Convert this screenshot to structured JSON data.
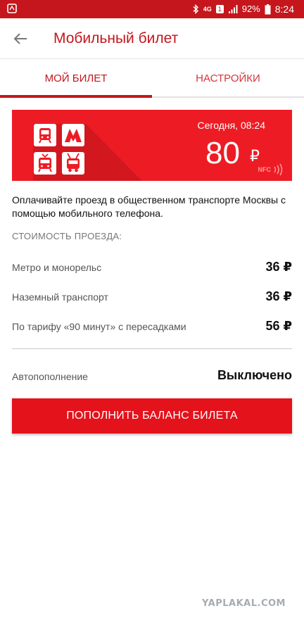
{
  "status_bar": {
    "network": "4G",
    "sim": "1",
    "battery": "92%",
    "time": "8:24",
    "icons": [
      "notification-icon",
      "bluetooth-icon",
      "signal-icon",
      "battery-icon"
    ]
  },
  "app_bar": {
    "title": "Мобильный билет",
    "back_icon": "arrow-left-icon"
  },
  "tabs": [
    {
      "label": "МОЙ БИЛЕТ",
      "active": true
    },
    {
      "label": "НАСТРОЙКИ",
      "active": false
    }
  ],
  "ticket": {
    "date": "Сегодня, 08:24",
    "amount": "80",
    "currency": "₽",
    "nfc_label": "NFC",
    "icons": [
      "train-icon",
      "metro-icon",
      "tram-icon",
      "trolleybus-icon"
    ],
    "bg_color": "#ed1c24"
  },
  "description": "Оплачивайте проезд в общественном транспорте Москвы с помощью мобильного телефона.",
  "fares": {
    "title": "СТОИМОСТЬ ПРОЕЗДА:",
    "items": [
      {
        "label": "Метро и монорельс",
        "price": "36 ₽"
      },
      {
        "label": "Наземный транспорт",
        "price": "36 ₽"
      },
      {
        "label": "По тарифу «90 минут» с пересадками",
        "price": "56 ₽"
      }
    ]
  },
  "autorefill": {
    "label": "Автопополнение",
    "value": "Выключено"
  },
  "topup_button": "ПОПОЛНИТЬ БАЛАНС БИЛЕТА",
  "watermark": "YAPLAKAL.COM",
  "colors": {
    "accent": "#c4161c",
    "button": "#e4121b"
  }
}
